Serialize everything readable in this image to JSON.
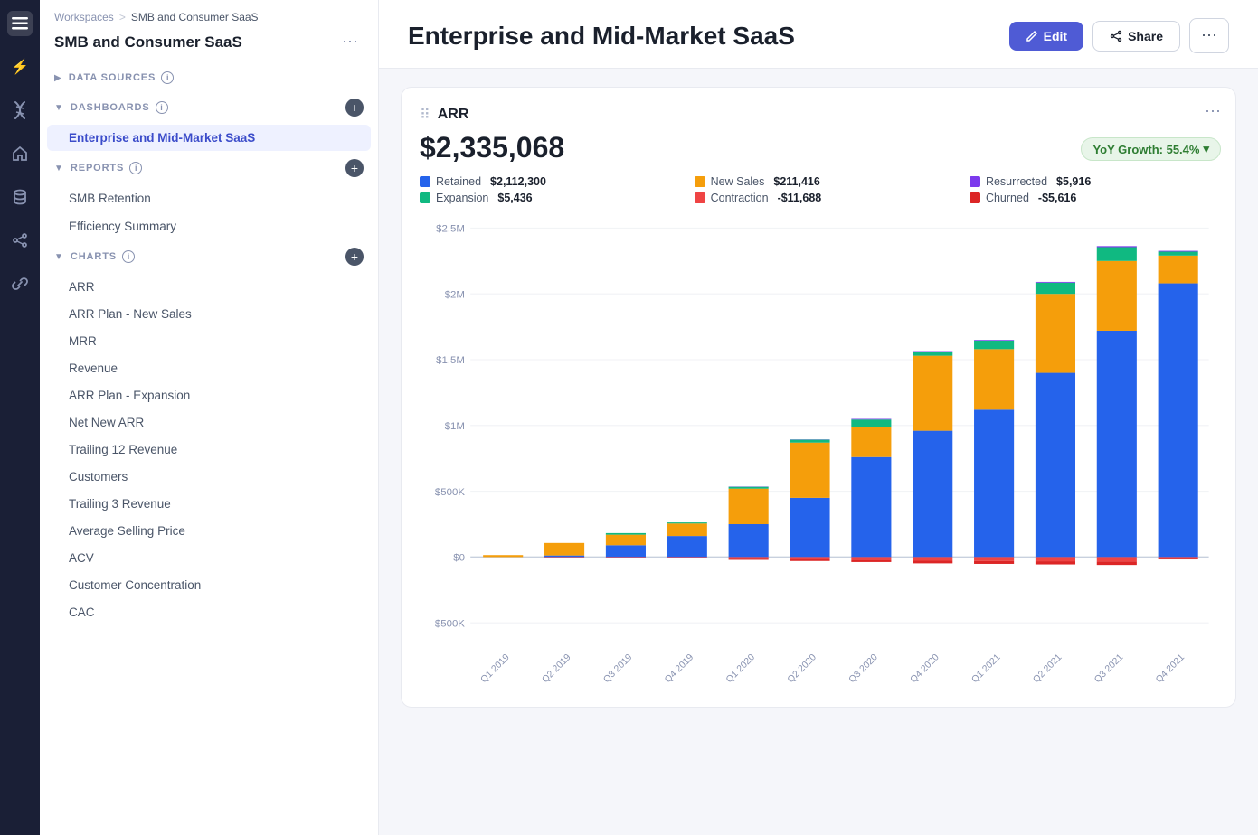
{
  "nav": {
    "icons": [
      "≡",
      "⚡",
      "🧬",
      "⊙",
      "🗄",
      "⌁",
      "🔗"
    ]
  },
  "leftPanel": {
    "breadcrumb": {
      "workspaces": "Workspaces",
      "sep": ">",
      "current": "SMB and Consumer SaaS"
    },
    "workspaceTitle": "SMB and Consumer SaaS",
    "sections": {
      "dataSources": "DATA SOURCES",
      "dashboards": "DASHBOARDS",
      "reports": "REPORTS",
      "charts": "CHARTS"
    },
    "activeItem": "Enterprise and Mid-Market SaaS",
    "reports": [
      "SMB Retention",
      "Efficiency Summary"
    ],
    "charts": [
      "ARR",
      "ARR Plan - New Sales",
      "MRR",
      "Revenue",
      "ARR Plan - Expansion",
      "Net New ARR",
      "Trailing 12 Revenue",
      "Customers",
      "Trailing 3 Revenue",
      "Average Selling Price",
      "ACV",
      "Customer Concentration",
      "CAC"
    ]
  },
  "header": {
    "title": "Enterprise and Mid-Market SaaS",
    "editLabel": "Edit",
    "shareLabel": "Share"
  },
  "chart": {
    "title": "ARR",
    "value": "$2,335,068",
    "yoyLabel": "YoY Growth: 55.4%",
    "legend": [
      {
        "label": "Retained",
        "color": "#2563eb",
        "value": "$2,112,300"
      },
      {
        "label": "New Sales",
        "color": "#f59e0b",
        "value": "$211,416"
      },
      {
        "label": "Resurrected",
        "color": "#7c3aed",
        "value": "$5,916"
      },
      {
        "label": "Expansion",
        "color": "#10b981",
        "value": "$5,436"
      },
      {
        "label": "Contraction",
        "color": "#ef4444",
        "value": "-$11,688"
      },
      {
        "label": "Churned",
        "color": "#dc2626",
        "value": "-$5,616"
      }
    ],
    "xLabels": [
      "Q1 2019",
      "Q2 2019",
      "Q3 2019",
      "Q4 2019",
      "Q1 2020",
      "Q2 2020",
      "Q3 2020",
      "Q4 2020",
      "Q1 2021",
      "Q2 2021",
      "Q3 2021",
      "Q4 2021"
    ],
    "yLabels": [
      "$2.5M",
      "$2M",
      "$1.5M",
      "$1M",
      "$500K",
      "$0",
      "-$500K"
    ],
    "bars": [
      {
        "quarter": "Q1 2019",
        "retained": 0,
        "newSales": 12,
        "expansion": 0,
        "resurrected": 0,
        "contraction": 0,
        "churned": 0
      },
      {
        "quarter": "Q2 2019",
        "retained": 12,
        "newSales": 90,
        "expansion": 0,
        "resurrected": 0,
        "contraction": -2,
        "churned": -1
      },
      {
        "quarter": "Q3 2019",
        "retained": 90,
        "newSales": 80,
        "expansion": 10,
        "resurrected": 0,
        "contraction": -3,
        "churned": -2
      },
      {
        "quarter": "Q4 2019",
        "retained": 160,
        "newSales": 90,
        "expansion": 8,
        "resurrected": 0,
        "contraction": -4,
        "churned": -3
      },
      {
        "quarter": "Q1 2020",
        "retained": 240,
        "newSales": 260,
        "expansion": 12,
        "resurrected": 2,
        "contraction": -10,
        "churned": -8
      },
      {
        "quarter": "Q2 2020",
        "retained": 440,
        "newSales": 400,
        "expansion": 20,
        "resurrected": 2,
        "contraction": -15,
        "churned": -10
      },
      {
        "quarter": "Q3 2020",
        "retained": 740,
        "newSales": 220,
        "expansion": 50,
        "resurrected": 5,
        "contraction": -20,
        "churned": -15
      },
      {
        "quarter": "Q4 2020",
        "retained": 940,
        "newSales": 560,
        "expansion": 30,
        "resurrected": 3,
        "contraction": -25,
        "churned": -18
      },
      {
        "quarter": "Q1 2021",
        "retained": 1100,
        "newSales": 440,
        "expansion": 60,
        "resurrected": 5,
        "contraction": -28,
        "churned": -20
      },
      {
        "quarter": "Q2 2021",
        "retained": 1380,
        "newSales": 580,
        "expansion": 80,
        "resurrected": 6,
        "contraction": -30,
        "churned": -22
      },
      {
        "quarter": "Q3 2021",
        "retained": 1700,
        "newSales": 520,
        "expansion": 100,
        "resurrected": 8,
        "contraction": -32,
        "churned": -24
      },
      {
        "quarter": "Q4 2021",
        "retained": 2080,
        "newSales": 211,
        "expansion": 30,
        "resurrected": 6,
        "contraction": -12,
        "churned": -6
      }
    ]
  }
}
